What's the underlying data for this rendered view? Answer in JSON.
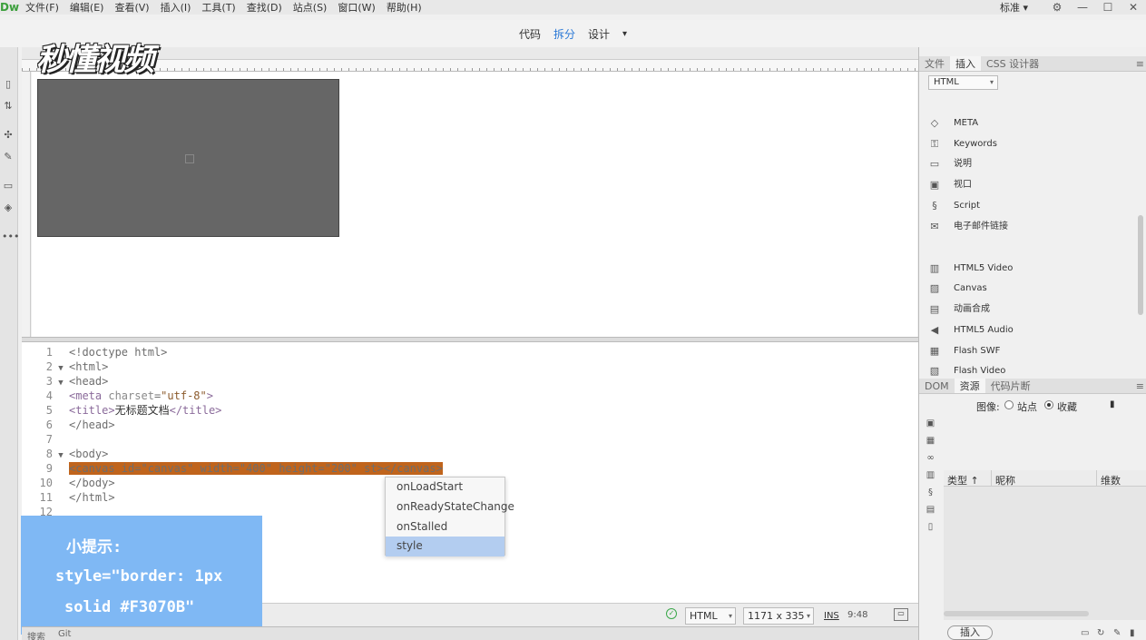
{
  "app": {
    "logo": "Dw"
  },
  "menu": [
    "文件(F)",
    "编辑(E)",
    "查看(V)",
    "插入(I)",
    "工具(T)",
    "查找(D)",
    "站点(S)",
    "窗口(W)",
    "帮助(H)"
  ],
  "workspace": {
    "layout_label": "标准",
    "layout_caret": "▾",
    "gear": "⚙",
    "minimize": "—",
    "maximize": "☐",
    "close": "✕"
  },
  "view_tabs": {
    "code": "代码",
    "split": "拆分",
    "design": "设计",
    "caret": "▾",
    "active": "split"
  },
  "watermark": "秒懂视频",
  "code_lines": [
    {
      "n": "1",
      "fold": "",
      "html": "&lt;!doctype html&gt;"
    },
    {
      "n": "2",
      "fold": "▼",
      "html": "&lt;html&gt;"
    },
    {
      "n": "3",
      "fold": "▼",
      "html": "&lt;head&gt;"
    },
    {
      "n": "4",
      "fold": "",
      "html": "&lt;meta charset=\"utf-8\"&gt;"
    },
    {
      "n": "5",
      "fold": "",
      "html": "&lt;title&gt;无标题文档&lt;/title&gt;"
    },
    {
      "n": "6",
      "fold": "",
      "html": "&lt;/head&gt;"
    },
    {
      "n": "7",
      "fold": "",
      "html": ""
    },
    {
      "n": "8",
      "fold": "▼",
      "html": "&lt;body&gt;"
    },
    {
      "n": "9",
      "fold": "",
      "html": "&lt;canvas id=\"canvas\" width=\"400\" height=\"200\" st&gt;&lt;/canvas&gt;"
    },
    {
      "n": "10",
      "fold": "",
      "html": "&lt;/body&gt;"
    },
    {
      "n": "11",
      "fold": "",
      "html": "&lt;/html&gt;"
    },
    {
      "n": "12",
      "fold": "",
      "html": ""
    }
  ],
  "autocomplete": {
    "items": [
      "onLoadStart",
      "onReadyStateChange",
      "onStalled",
      "style"
    ],
    "selected_index": 3
  },
  "tip": {
    "title": "小提示:",
    "line1": "style=\"border: 1px",
    "line2": "solid #F3070B\""
  },
  "status": {
    "lang": "HTML",
    "size": "1171 x 335",
    "ins": "INS",
    "pos": "9:48",
    "ok_icon": "✓",
    "preview_icon": "▭"
  },
  "bottom_tabs": [
    "搜索",
    "Git"
  ],
  "right_panel": {
    "tabs": [
      "文件",
      "插入",
      "CSS 设计器"
    ],
    "active_tab": "插入",
    "category": "HTML",
    "items": [
      {
        "icon": "tag-icon",
        "glyph": "◇",
        "label": "META"
      },
      {
        "icon": "key-icon",
        "glyph": "⚿",
        "label": "Keywords"
      },
      {
        "icon": "comment-icon",
        "glyph": "▭",
        "label": "说明"
      },
      {
        "icon": "viewport-icon",
        "glyph": "▣",
        "label": "视口"
      },
      {
        "icon": "script-icon",
        "glyph": "§",
        "label": "Script"
      },
      {
        "icon": "mail-icon",
        "glyph": "✉",
        "label": "电子邮件链接"
      },
      {
        "icon": "video-icon",
        "glyph": "▥",
        "label": "HTML5 Video"
      },
      {
        "icon": "canvas-icon",
        "glyph": "▨",
        "label": "Canvas"
      },
      {
        "icon": "animation-icon",
        "glyph": "▤",
        "label": "动画合成"
      },
      {
        "icon": "audio-icon",
        "glyph": "◀",
        "label": "HTML5 Audio"
      },
      {
        "icon": "flash-swf-icon",
        "glyph": "▦",
        "label": "Flash SWF"
      },
      {
        "icon": "flash-video-icon",
        "glyph": "▧",
        "label": "Flash Video"
      }
    ],
    "lower_tabs": [
      "DOM",
      "资源",
      "代码片断"
    ],
    "lower_active": "资源",
    "assets": {
      "image_label": "图像:",
      "site": "站点",
      "favorites": "收藏",
      "selected": "收藏",
      "bookmark": "▮"
    },
    "table_headers": [
      "类型 ↑",
      "昵称",
      "维数"
    ],
    "insert_button": "插入",
    "menu_glyph": "≡"
  }
}
